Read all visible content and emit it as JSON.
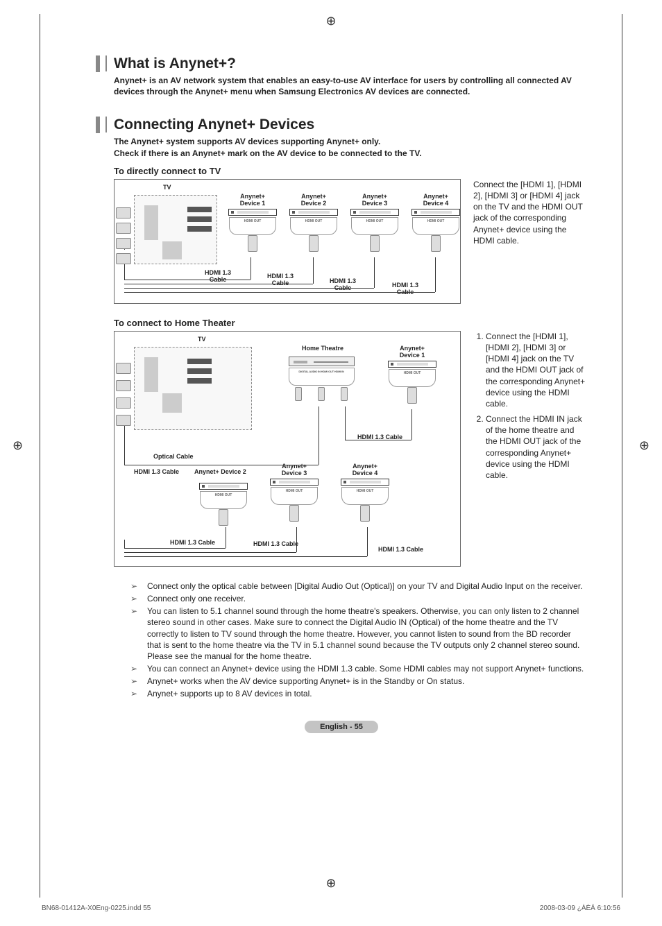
{
  "section1": {
    "title": "What is Anynet+?",
    "intro": "Anynet+ is an AV network system that enables an easy-to-use AV interface for users by controlling all connected AV devices through the Anynet+ menu when Samsung Electronics AV devices are connected."
  },
  "section2": {
    "title": "Connecting Anynet+ Devices",
    "intro_line1": "The Anynet+ system supports AV devices supporting Anynet+ only.",
    "intro_line2": "Check if there is an Anynet+ mark on the AV device to be connected to the TV."
  },
  "subhead1": "To directly connect to TV",
  "subhead2": "To connect to Home Theater",
  "diagram1": {
    "tv": "TV",
    "dev1": "Anynet+\nDevice 1",
    "dev2": "Anynet+\nDevice 2",
    "dev3": "Anynet+\nDevice 3",
    "dev4": "Anynet+\nDevice 4",
    "cable": "HDMI 1.3\nCable",
    "hdmiout": "HDMI OUT",
    "side_text": "Connect the [HDMI 1], [HDMI 2], [HDMI 3] or [HDMI 4] jack on the TV and the HDMI OUT jack of the corresponding Anynet+ device using the HDMI cable."
  },
  "diagram2": {
    "tv": "TV",
    "home_theatre": "Home Theatre",
    "dev1": "Anynet+\nDevice 1",
    "dev2": "Anynet+ Device 2",
    "dev3": "Anynet+\nDevice 3",
    "dev4": "Anynet+\nDevice 4",
    "optical": "Optical Cable",
    "hdmi13": "HDMI 1.3 Cable",
    "side_step1": "Connect the [HDMI 1], [HDMI 2], [HDMI 3] or [HDMI 4] jack on the TV and the HDMI OUT jack of the corresponding Anynet+ device using the HDMI cable.",
    "side_step2": "Connect the HDMI IN jack of the home theatre and the HDMI OUT jack of the corresponding Anynet+ device using the HDMI cable."
  },
  "notes": [
    "Connect only the optical cable between [Digital Audio Out (Optical)] on your TV and Digital Audio Input on the receiver.",
    "Connect only one receiver.",
    "You can listen to 5.1 channel sound through the home theatre's speakers. Otherwise, you can only listen to 2 channel stereo sound in other cases. Make sure to connect the Digital Audio IN (Optical) of the home theatre and the TV correctly to listen to TV sound through the home theatre. However, you cannot listen to sound from the BD recorder that is sent to the home theatre via the TV in 5.1 channel sound because the TV outputs only 2 channel stereo sound. Please see the manual for the home theatre.",
    "You can connect an Anynet+ device using the HDMI 1.3 cable. Some HDMI cables may not support Anynet+ functions.",
    "Anynet+ works when the AV device supporting Anynet+ is in the Standby or On status.",
    "Anynet+ supports up to 8 AV devices in total."
  ],
  "footer": {
    "page_label": "English - 55",
    "file_info": "BN68-01412A-X0Eng-0225.indd   55",
    "timestamp": "2008-03-09   ¿ÀÈÄ 6:10:56"
  }
}
